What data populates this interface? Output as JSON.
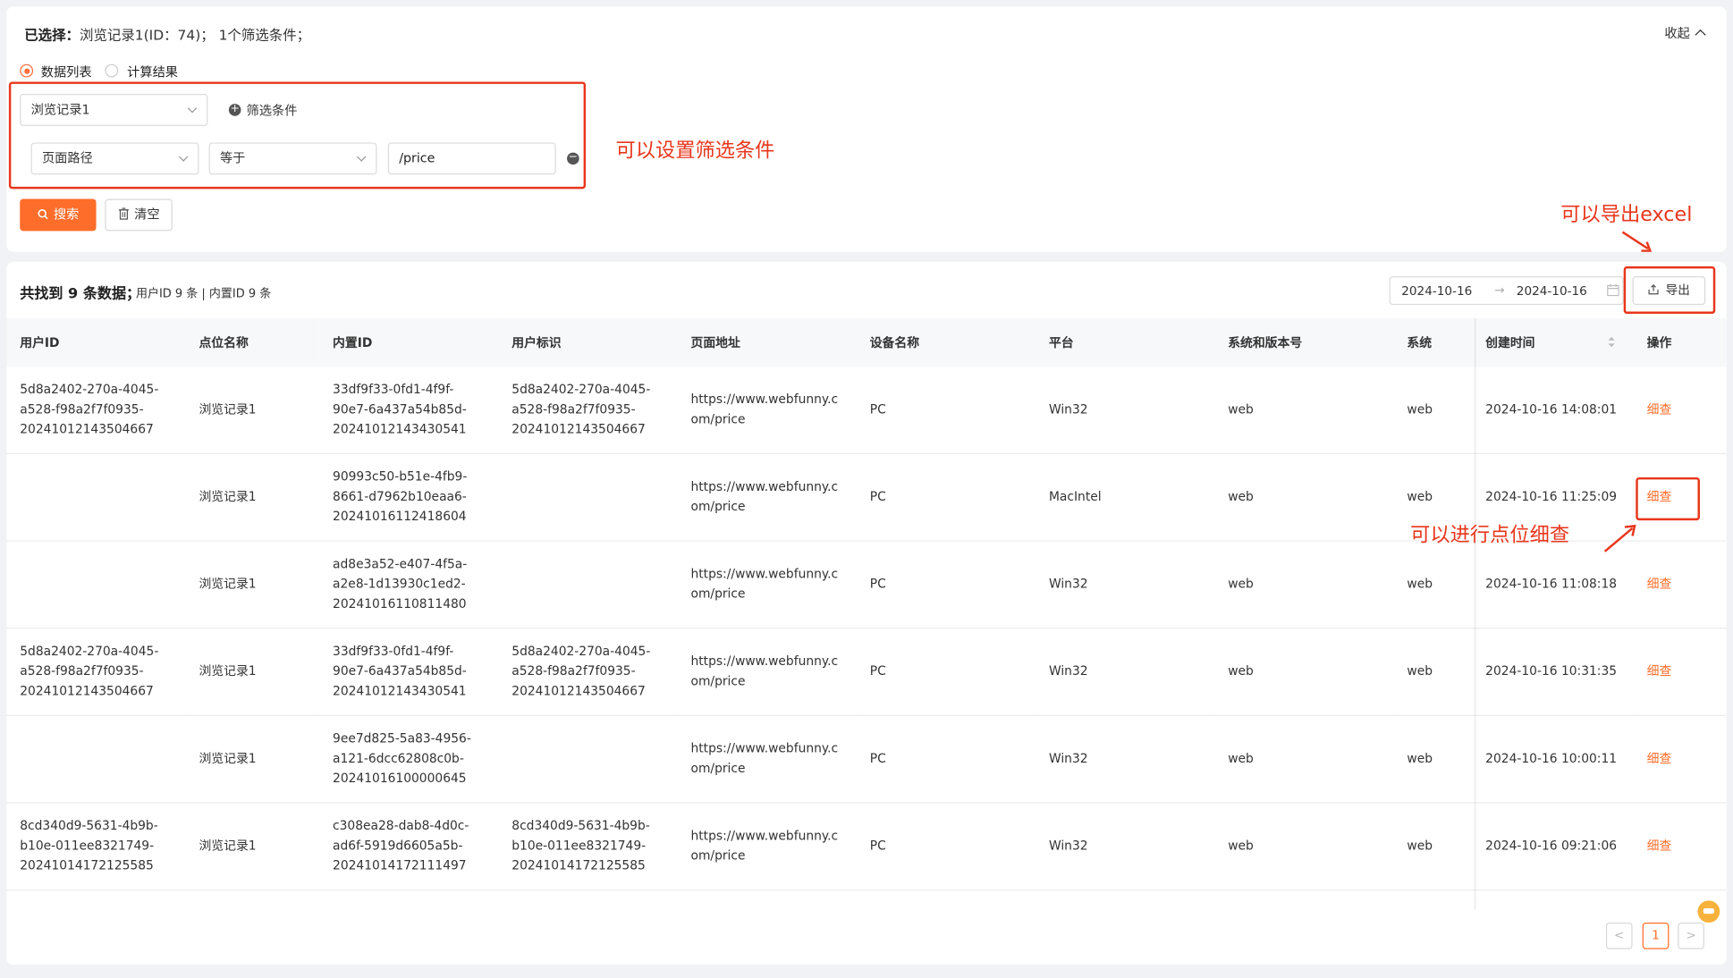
{
  "selection": {
    "label": "已选择：",
    "text": "浏览记录1(ID：74)；  1个筛选条件；",
    "collapse_label": "收起"
  },
  "view_mode": {
    "options": [
      "数据列表",
      "计算结果"
    ],
    "selected": "数据列表"
  },
  "filter": {
    "event_select": "浏览记录1",
    "add_condition_label": "筛选条件",
    "condition": {
      "field": "页面路径",
      "operator": "等于",
      "value": "/price"
    }
  },
  "actions": {
    "search_label": "搜索",
    "clear_label": "清空"
  },
  "results": {
    "summary": "共找到 9 条数据；",
    "summary_detail": "用户ID 9 条 | 内置ID 9 条",
    "date_start": "2024-10-16",
    "date_end": "2024-10-16",
    "date_separator": "→",
    "export_label": "导出"
  },
  "table": {
    "columns": [
      "用户ID",
      "点位名称",
      "内置ID",
      "用户标识",
      "页面地址",
      "设备名称",
      "平台",
      "系统和版本号",
      "系统",
      "创建时间",
      "操作"
    ],
    "rows": [
      {
        "user_id": "5d8a2402-270a-4045-\na528-f98a2f7f0935-\n20241012143504667",
        "event": "浏览记录1",
        "builtin_id": "33df9f33-0fd1-4f9f-\n90e7-6a437a54b85d-\n20241012143430541",
        "user_tag": "5d8a2402-270a-4045-\na528-f98a2f7f0935-\n20241012143504667",
        "url": "https://www.webfunny.c\nom/price",
        "device": "PC",
        "platform": "Win32",
        "os_version": "web",
        "os": "web",
        "created": "2024-10-16 14:08:01",
        "op": "细查"
      },
      {
        "user_id": "",
        "event": "浏览记录1",
        "builtin_id": "90993c50-b51e-4fb9-\n8661-d7962b10eaa6-\n20241016112418604",
        "user_tag": "",
        "url": "https://www.webfunny.c\nom/price",
        "device": "PC",
        "platform": "MacIntel",
        "os_version": "web",
        "os": "web",
        "created": "2024-10-16 11:25:09",
        "op": "细查"
      },
      {
        "user_id": "",
        "event": "浏览记录1",
        "builtin_id": "ad8e3a52-e407-4f5a-\na2e8-1d13930c1ed2-\n20241016110811480",
        "user_tag": "",
        "url": "https://www.webfunny.c\nom/price",
        "device": "PC",
        "platform": "Win32",
        "os_version": "web",
        "os": "web",
        "created": "2024-10-16 11:08:18",
        "op": "细查"
      },
      {
        "user_id": "5d8a2402-270a-4045-\na528-f98a2f7f0935-\n20241012143504667",
        "event": "浏览记录1",
        "builtin_id": "33df9f33-0fd1-4f9f-\n90e7-6a437a54b85d-\n20241012143430541",
        "user_tag": "5d8a2402-270a-4045-\na528-f98a2f7f0935-\n20241012143504667",
        "url": "https://www.webfunny.c\nom/price",
        "device": "PC",
        "platform": "Win32",
        "os_version": "web",
        "os": "web",
        "created": "2024-10-16 10:31:35",
        "op": "细查"
      },
      {
        "user_id": "",
        "event": "浏览记录1",
        "builtin_id": "9ee7d825-5a83-4956-\na121-6dcc62808c0b-\n20241016100000645",
        "user_tag": "",
        "url": "https://www.webfunny.c\nom/price",
        "device": "PC",
        "platform": "Win32",
        "os_version": "web",
        "os": "web",
        "created": "2024-10-16 10:00:11",
        "op": "细查"
      },
      {
        "user_id": "8cd340d9-5631-4b9b-\nb10e-011ee8321749-\n20241014172125585",
        "event": "浏览记录1",
        "builtin_id": "c308ea28-dab8-4d0c-\nad6f-5919d6605a5b-\n20241014172111497",
        "user_tag": "8cd340d9-5631-4b9b-\nb10e-011ee8321749-\n20241014172125585",
        "url": "https://www.webfunny.c\nom/price",
        "device": "PC",
        "platform": "Win32",
        "os_version": "web",
        "os": "web",
        "created": "2024-10-16 09:21:06",
        "op": "细查"
      }
    ]
  },
  "pagination": {
    "prev": "<",
    "current": "1",
    "next": ">"
  },
  "annotations": {
    "filter_note": "可以设置筛选条件",
    "export_note": "可以导出excel",
    "detail_note": "可以进行点位细查",
    "color": "#e8361c"
  },
  "theme": {
    "accent": "#ff6d2a"
  }
}
